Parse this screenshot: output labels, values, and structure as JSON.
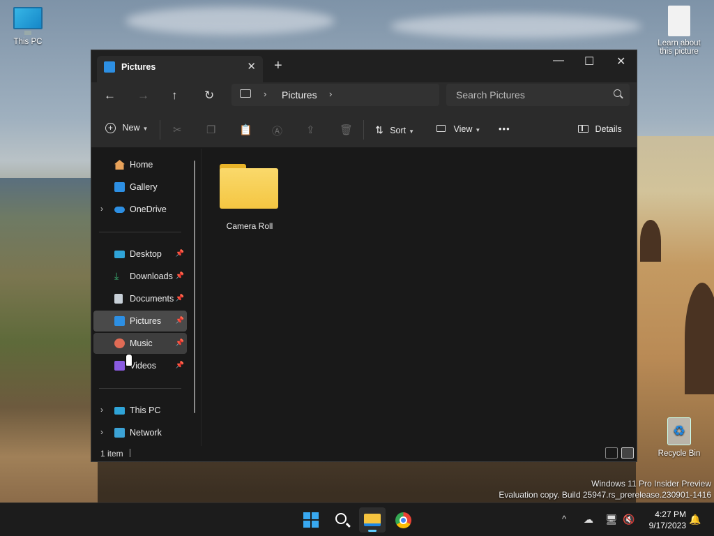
{
  "desktop": {
    "icons": {
      "this_pc": "This PC",
      "learn_picture": "Learn about this picture",
      "recycle_bin": "Recycle Bin"
    },
    "watermark": {
      "line1": "Windows 11 Pro Insider Preview",
      "line2": "Evaluation copy. Build 25947.rs_prerelease.230901-1416"
    }
  },
  "window": {
    "tab_title": "Pictures",
    "tab_close": "✕",
    "new_tab": "+",
    "controls": {
      "minimize": "—",
      "maximize": "☐",
      "close": "✕"
    },
    "nav": {
      "back": "←",
      "forward": "→",
      "up": "↑",
      "refresh": "↻"
    },
    "address": {
      "separator": "›",
      "crumb": "Pictures"
    },
    "search": {
      "placeholder": "Search Pictures"
    },
    "command_bar": {
      "new_label": "New",
      "sort_label": "Sort",
      "view_label": "View",
      "more": "•••",
      "details_label": "Details"
    },
    "sidebar": {
      "items": [
        {
          "label": "Home",
          "icon": "home-icon"
        },
        {
          "label": "Gallery",
          "icon": "gallery-icon"
        },
        {
          "label": "OneDrive",
          "icon": "onedrive-icon",
          "expand": "›"
        },
        {
          "label": "Desktop",
          "icon": "desktop-icon",
          "pin": "📌"
        },
        {
          "label": "Downloads",
          "icon": "downloads-icon",
          "pin": "📌"
        },
        {
          "label": "Documents",
          "icon": "documents-icon",
          "pin": "📌"
        },
        {
          "label": "Pictures",
          "icon": "pictures-icon",
          "pin": "📌",
          "selected": true
        },
        {
          "label": "Music",
          "icon": "music-icon",
          "pin": "📌"
        },
        {
          "label": "Videos",
          "icon": "videos-icon",
          "pin": "📌"
        },
        {
          "label": "This PC",
          "icon": "this-pc-icon",
          "expand": "›"
        },
        {
          "label": "Network",
          "icon": "network-icon",
          "expand": "›"
        }
      ]
    },
    "content": {
      "items": [
        {
          "name": "Camera Roll",
          "type": "folder"
        }
      ]
    },
    "status": {
      "count": "1 item"
    }
  },
  "taskbar": {
    "apps": [
      "start-icon",
      "search-icon",
      "file-explorer-icon",
      "chrome-icon"
    ],
    "tray": {
      "chevron": "^"
    },
    "clock": {
      "time": "4:27 PM",
      "date": "9/17/2023"
    }
  }
}
